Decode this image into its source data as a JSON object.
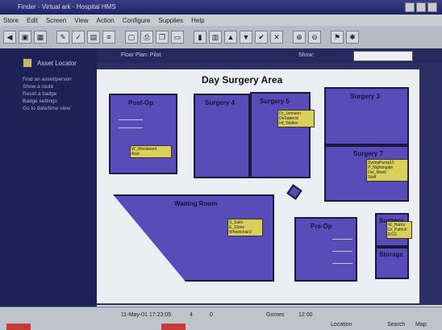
{
  "window": {
    "title": "Finder - Virtual ark - Hospital HMS"
  },
  "menu": [
    "Store",
    "Edit",
    "Screen",
    "View",
    "Action",
    "Configure",
    "Supplies",
    "Help"
  ],
  "left_panel": {
    "header": "Asset Locator",
    "items": [
      "Find an asset/person",
      "Show a route",
      "Reset a badge",
      "Badge settings",
      "Go to date/time view"
    ]
  },
  "main": {
    "path": "Floor Plan: Pilot",
    "show_label": "Show:",
    "map_title": "Day Surgery Area"
  },
  "rooms": [
    {
      "label": "Post-Op"
    },
    {
      "label": "Surgery 4"
    },
    {
      "label": "Surgery 5"
    },
    {
      "label": "Surgery 3"
    },
    {
      "label": "Surgery 7"
    },
    {
      "label": "Waiting Room"
    },
    {
      "label": "Pre-Op"
    },
    {
      "label": "Surgery"
    },
    {
      "label": "Storage"
    }
  ],
  "tags": [
    [
      "W_Woodward",
      "Asst"
    ],
    [
      "Dr_Johnson",
      "DeSaberid",
      "Inf_Walker"
    ],
    [
      "SyringPump15",
      "P_Nightingale",
      "Oxt_Monit",
      "Staff"
    ],
    [
      "S_Sulls",
      "E_Stone",
      "Wheelchair3"
    ],
    [
      "W_Harris",
      "Dr_Patrick",
      "ECG"
    ]
  ],
  "status": {
    "datetime": "11-May-01 17:23:05",
    "count1": "4",
    "count2": "0",
    "user": "Gomes",
    "code": "12:00",
    "right1": "Location",
    "right2": "Search",
    "right3": "Map"
  }
}
